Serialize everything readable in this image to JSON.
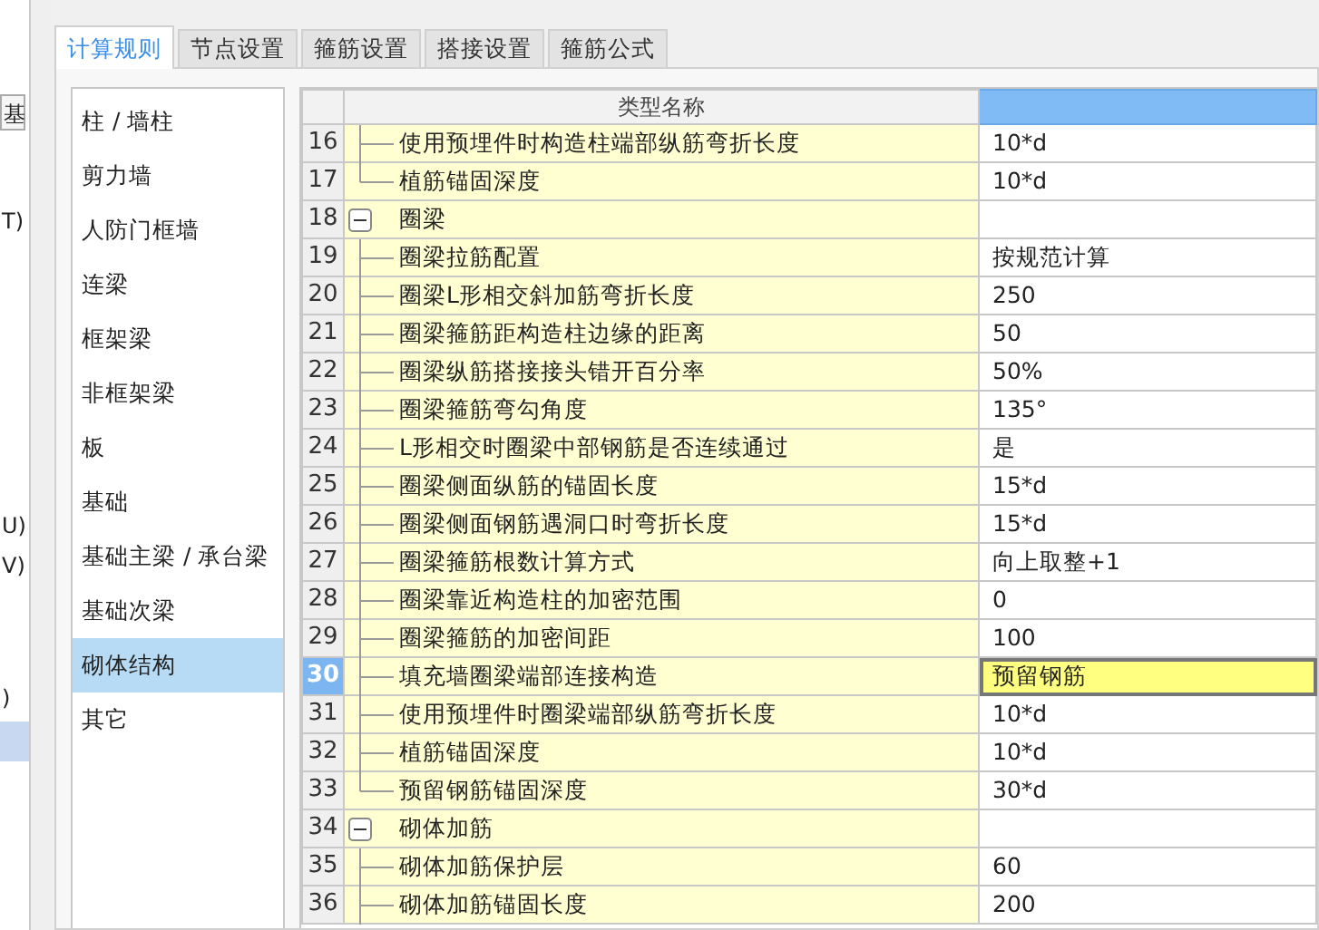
{
  "background_window": {
    "fragments": [
      "基",
      "T)",
      "U)",
      "V)",
      ")"
    ],
    "row_selected": true
  },
  "tabs": [
    {
      "label": "计算规则",
      "selected": true
    },
    {
      "label": "节点设置",
      "selected": false
    },
    {
      "label": "箍筋设置",
      "selected": false
    },
    {
      "label": "搭接设置",
      "selected": false
    },
    {
      "label": "箍筋公式",
      "selected": false
    }
  ],
  "categories": [
    {
      "label": "柱 / 墙柱",
      "selected": false
    },
    {
      "label": "剪力墙",
      "selected": false
    },
    {
      "label": "人防门框墙",
      "selected": false
    },
    {
      "label": "连梁",
      "selected": false
    },
    {
      "label": "框架梁",
      "selected": false
    },
    {
      "label": "非框架梁",
      "selected": false
    },
    {
      "label": "板",
      "selected": false
    },
    {
      "label": "基础",
      "selected": false
    },
    {
      "label": "基础主梁 / 承台梁",
      "selected": false
    },
    {
      "label": "基础次梁",
      "selected": false
    },
    {
      "label": "砌体结构",
      "selected": true
    },
    {
      "label": "其它",
      "selected": false
    }
  ],
  "table": {
    "columns": [
      "类型名称"
    ],
    "groups": [
      {
        "children": [
          {
            "number": "16",
            "name": "使用预埋件时构造柱端部纵筋弯折长度",
            "value": "10*d",
            "selected": false,
            "last": false
          },
          {
            "number": "17",
            "name": "植筋锚固深度",
            "value": "10*d",
            "selected": false,
            "last": true
          }
        ]
      },
      {
        "number": "18",
        "name": "圈梁",
        "expanded": true,
        "children": [
          {
            "number": "19",
            "name": "圈梁拉筋配置",
            "value": "按规范计算",
            "selected": false,
            "last": false
          },
          {
            "number": "20",
            "name": "圈梁L形相交斜加筋弯折长度",
            "value": "250",
            "selected": false,
            "last": false
          },
          {
            "number": "21",
            "name": "圈梁箍筋距构造柱边缘的距离",
            "value": "50",
            "selected": false,
            "last": false
          },
          {
            "number": "22",
            "name": "圈梁纵筋搭接接头错开百分率",
            "value": "50%",
            "selected": false,
            "last": false
          },
          {
            "number": "23",
            "name": "圈梁箍筋弯勾角度",
            "value": "135°",
            "selected": false,
            "last": false
          },
          {
            "number": "24",
            "name": "L形相交时圈梁中部钢筋是否连续通过",
            "value": "是",
            "selected": false,
            "last": false
          },
          {
            "number": "25",
            "name": "圈梁侧面纵筋的锚固长度",
            "value": "15*d",
            "selected": false,
            "last": false
          },
          {
            "number": "26",
            "name": "圈梁侧面钢筋遇洞口时弯折长度",
            "value": "15*d",
            "selected": false,
            "last": false
          },
          {
            "number": "27",
            "name": "圈梁箍筋根数计算方式",
            "value": "向上取整+1",
            "selected": false,
            "last": false
          },
          {
            "number": "28",
            "name": "圈梁靠近构造柱的加密范围",
            "value": "0",
            "selected": false,
            "last": false
          },
          {
            "number": "29",
            "name": "圈梁箍筋的加密间距",
            "value": "100",
            "selected": false,
            "last": false
          },
          {
            "number": "30",
            "name": "填充墙圈梁端部连接构造",
            "value": "预留钢筋",
            "selected": true,
            "last": false
          },
          {
            "number": "31",
            "name": "使用预埋件时圈梁端部纵筋弯折长度",
            "value": "10*d",
            "selected": false,
            "last": false
          },
          {
            "number": "32",
            "name": "植筋锚固深度",
            "value": "10*d",
            "selected": false,
            "last": false
          },
          {
            "number": "33",
            "name": "预留钢筋锚固深度",
            "value": "30*d",
            "selected": false,
            "last": true
          }
        ]
      },
      {
        "number": "34",
        "name": "砌体加筋",
        "expanded": true,
        "children": [
          {
            "number": "35",
            "name": "砌体加筋保护层",
            "value": "60",
            "selected": false,
            "last": false
          },
          {
            "number": "36",
            "name": "砌体加筋锚固长度",
            "value": "200",
            "selected": false,
            "last": false
          }
        ]
      }
    ]
  }
}
